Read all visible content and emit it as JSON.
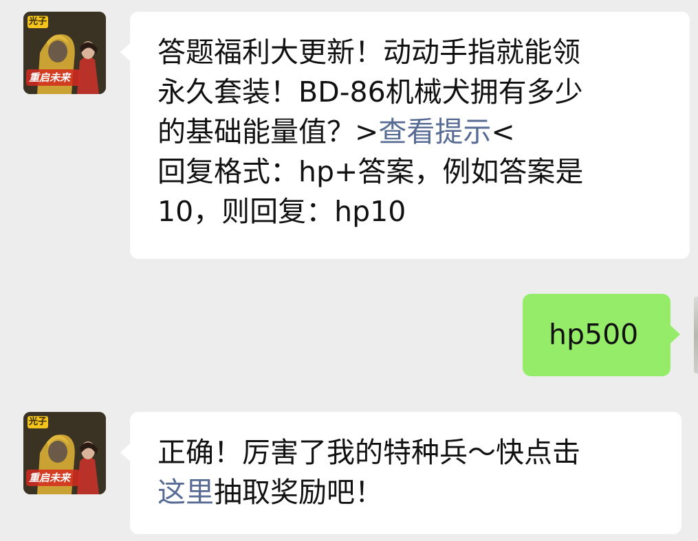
{
  "messages": [
    {
      "sender": "bot",
      "avatar_text": {
        "top": "光子",
        "bottom": "重启未来"
      },
      "lines": [
        [
          "答题福利大更新！动动手指就能领"
        ],
        [
          "永久套装！BD-86机械犬拥有多少"
        ],
        [
          "的基础能量值？>",
          "查看提示",
          "<"
        ],
        [
          "回复格式：hp+答案，例如答案是"
        ],
        [
          "10，则回复：hp10"
        ]
      ]
    },
    {
      "sender": "user",
      "text": "hp500"
    },
    {
      "sender": "bot",
      "avatar_text": {
        "top": "光子",
        "bottom": "重启未来"
      },
      "lines": [
        [
          "正确！厉害了我的特种兵～快点击"
        ],
        [
          "这里",
          "抽取奖励吧！"
        ]
      ]
    }
  ],
  "colors": {
    "background": "#ededed",
    "bot_bubble": "#ffffff",
    "user_bubble": "#95ec69",
    "link": "#576b95",
    "text": "#111111"
  }
}
